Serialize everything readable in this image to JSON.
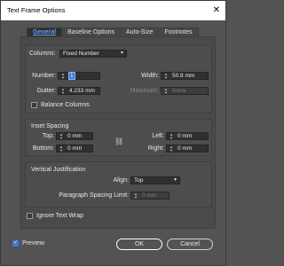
{
  "window": {
    "title": "Text Frame Options",
    "close_glyph": "✕"
  },
  "tabs": [
    {
      "label": "General",
      "active": true
    },
    {
      "label": "Baseline Options",
      "active": false
    },
    {
      "label": "Auto-Size",
      "active": false
    },
    {
      "label": "Footnotes",
      "active": false
    }
  ],
  "columns": {
    "label": "Columns:",
    "value": "Fixed Number",
    "number_label": "Number:",
    "number_value": "1",
    "width_label": "Width:",
    "width_value": "50.8 mm",
    "gutter_label": "Gutter:",
    "gutter_value": "4.233 mm",
    "maximum_label": "Maximum:",
    "maximum_value": "None",
    "balance_label": "Balance Columns",
    "balance_checked": false
  },
  "inset": {
    "title": "Inset Spacing",
    "top_label": "Top:",
    "top_value": "0 mm",
    "bottom_label": "Bottom:",
    "bottom_value": "0 mm",
    "left_label": "Left:",
    "left_value": "0 mm",
    "right_label": "Right:",
    "right_value": "0 mm"
  },
  "vertical": {
    "title": "Vertical Justification",
    "align_label": "Align:",
    "align_value": "Top",
    "limit_label": "Paragraph Spacing Limit:",
    "limit_value": "0 mm"
  },
  "ignore_wrap": {
    "label": "Ignore Text Wrap",
    "checked": false
  },
  "preview": {
    "label": "Preview",
    "checked": true,
    "check_glyph": "✓"
  },
  "buttons": {
    "ok": "OK",
    "cancel": "Cancel"
  },
  "icons": {
    "spinner": "up-down-arrows",
    "chain": "chain-link-icon",
    "caret": "chevron-down-icon"
  }
}
